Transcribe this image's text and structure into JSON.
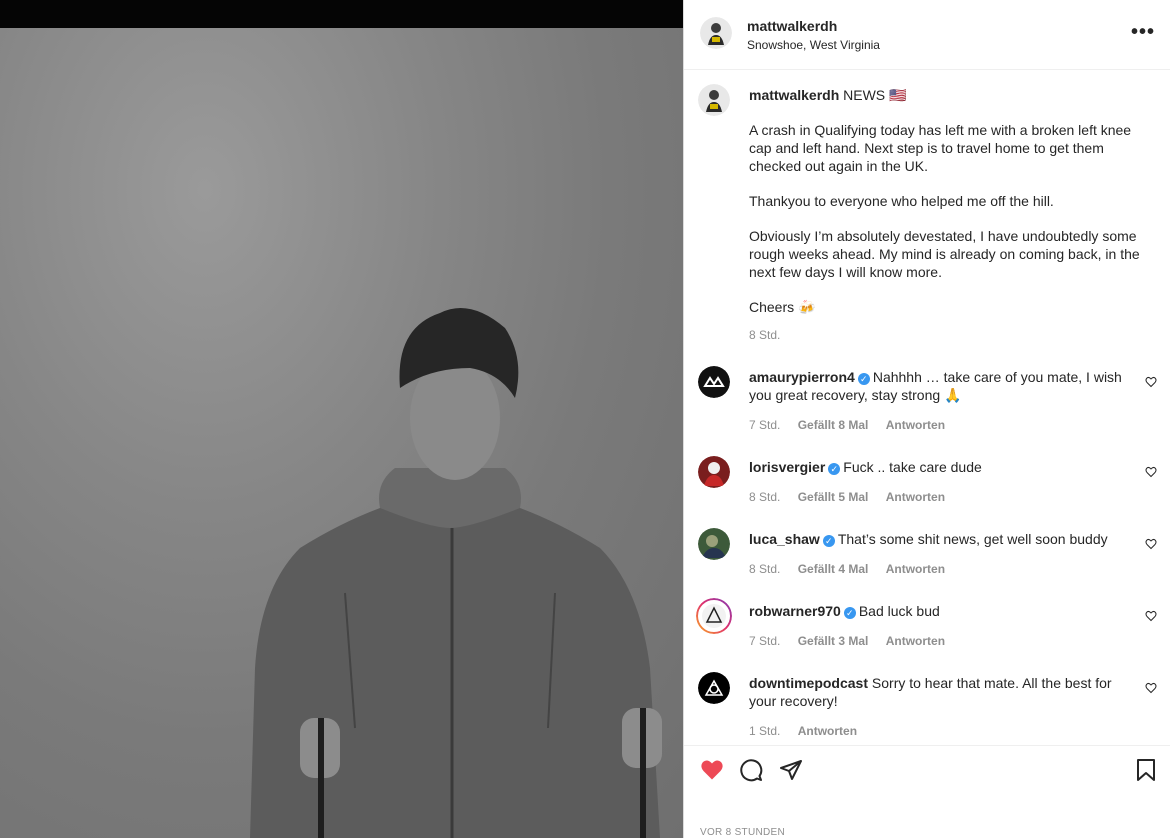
{
  "post": {
    "username": "mattwalkerdh",
    "location": "Snowshoe, West Virginia",
    "more_label": "•••"
  },
  "caption": {
    "username": "mattwalkerdh",
    "headline": "NEWS 🇺🇸",
    "paragraphs": [
      "A crash in Qualifying today has left me with a broken left knee cap and left hand. Next step is to travel home to get them checked out again in the UK.",
      "Thankyou to everyone who helped me off the hill.",
      "Obviously I’m absolutely devestated, I have undoubtedly some rough weeks ahead. My mind is already on coming back, in the next few days I will know more.",
      "Cheers 🍻"
    ],
    "time": "8 Std."
  },
  "comments": [
    {
      "username": "amaurypierron4",
      "verified": true,
      "text": "Nahhhh … take care of you mate, I wish you great recovery, stay strong 🙏",
      "time": "7 Std.",
      "likes": "Gefällt 8 Mal",
      "reply": "Antworten"
    },
    {
      "username": "lorisvergier",
      "verified": true,
      "text": "Fuck .. take care dude",
      "time": "8 Std.",
      "likes": "Gefällt 5 Mal",
      "reply": "Antworten"
    },
    {
      "username": "luca_shaw",
      "verified": true,
      "text": "That’s some shit news, get well soon buddy",
      "time": "8 Std.",
      "likes": "Gefällt 4 Mal",
      "reply": "Antworten"
    },
    {
      "username": "robwarner970",
      "verified": true,
      "text": "Bad luck bud",
      "time": "7 Std.",
      "likes": "Gefällt 3 Mal",
      "reply": "Antworten"
    },
    {
      "username": "downtimepodcast",
      "verified": false,
      "text": "Sorry to hear that mate. All the best for your recovery!",
      "time": "1 Std.",
      "likes": "",
      "reply": "Antworten"
    }
  ],
  "actions": {
    "like_icon": "heart-filled-icon",
    "comment_icon": "comment-icon",
    "share_icon": "share-icon",
    "save_icon": "bookmark-icon"
  },
  "footer": {
    "time": "VOR 8 STUNDEN"
  },
  "colors": {
    "like_red": "#ed4956",
    "verified_blue": "#3897f0",
    "meta_gray": "#8e8e8e"
  }
}
